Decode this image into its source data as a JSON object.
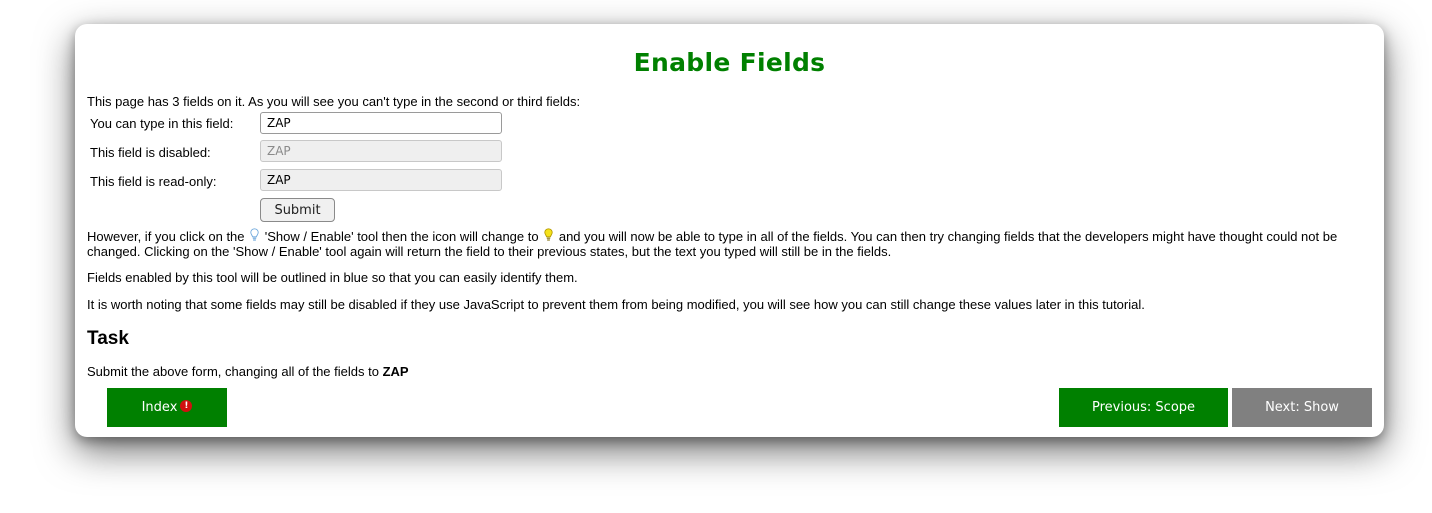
{
  "page": {
    "title": "Enable Fields",
    "intro": "This page has 3 fields on it. As you will see you can't type in the second or third fields:"
  },
  "form": {
    "field1": {
      "label": "You can type in this field:",
      "value": "ZAP"
    },
    "field2": {
      "label": "This field is disabled:",
      "value": "ZAP"
    },
    "field3": {
      "label": "This field is read-only:",
      "value": "ZAP"
    },
    "submit_label": "Submit"
  },
  "body": {
    "para1_a": "However, if you click on the",
    "para1_b": "'Show / Enable' tool then the icon will change to",
    "para1_c": "and you will now be able to type in all of the fields. You can then try changing fields that the developers might have thought could not be changed. Clicking on the 'Show / Enable' tool again will return the field to their previous states, but the text you typed will still be in the fields.",
    "para2": "Fields enabled by this tool will be outlined in blue so that you can easily identify them.",
    "para3": "It is worth noting that some fields may still be disabled if they use JavaScript to prevent them from being modified, you will see how you can still change these values later in this tutorial."
  },
  "task": {
    "title": "Task",
    "text_prefix": "Submit the above form, changing all of the fields to",
    "text_bold": "ZAP"
  },
  "nav": {
    "index_label": "Index",
    "alert_glyph": "!",
    "previous_label": "Previous: Scope",
    "next_label": "Next: Show"
  },
  "colors": {
    "accent_green": "#008000",
    "disabled_gray": "#808080",
    "alert_red": "#d01010"
  },
  "icons": {
    "bulb_off": "lightbulb-outline-icon",
    "bulb_on": "lightbulb-yellow-icon",
    "alert": "alert-icon"
  }
}
